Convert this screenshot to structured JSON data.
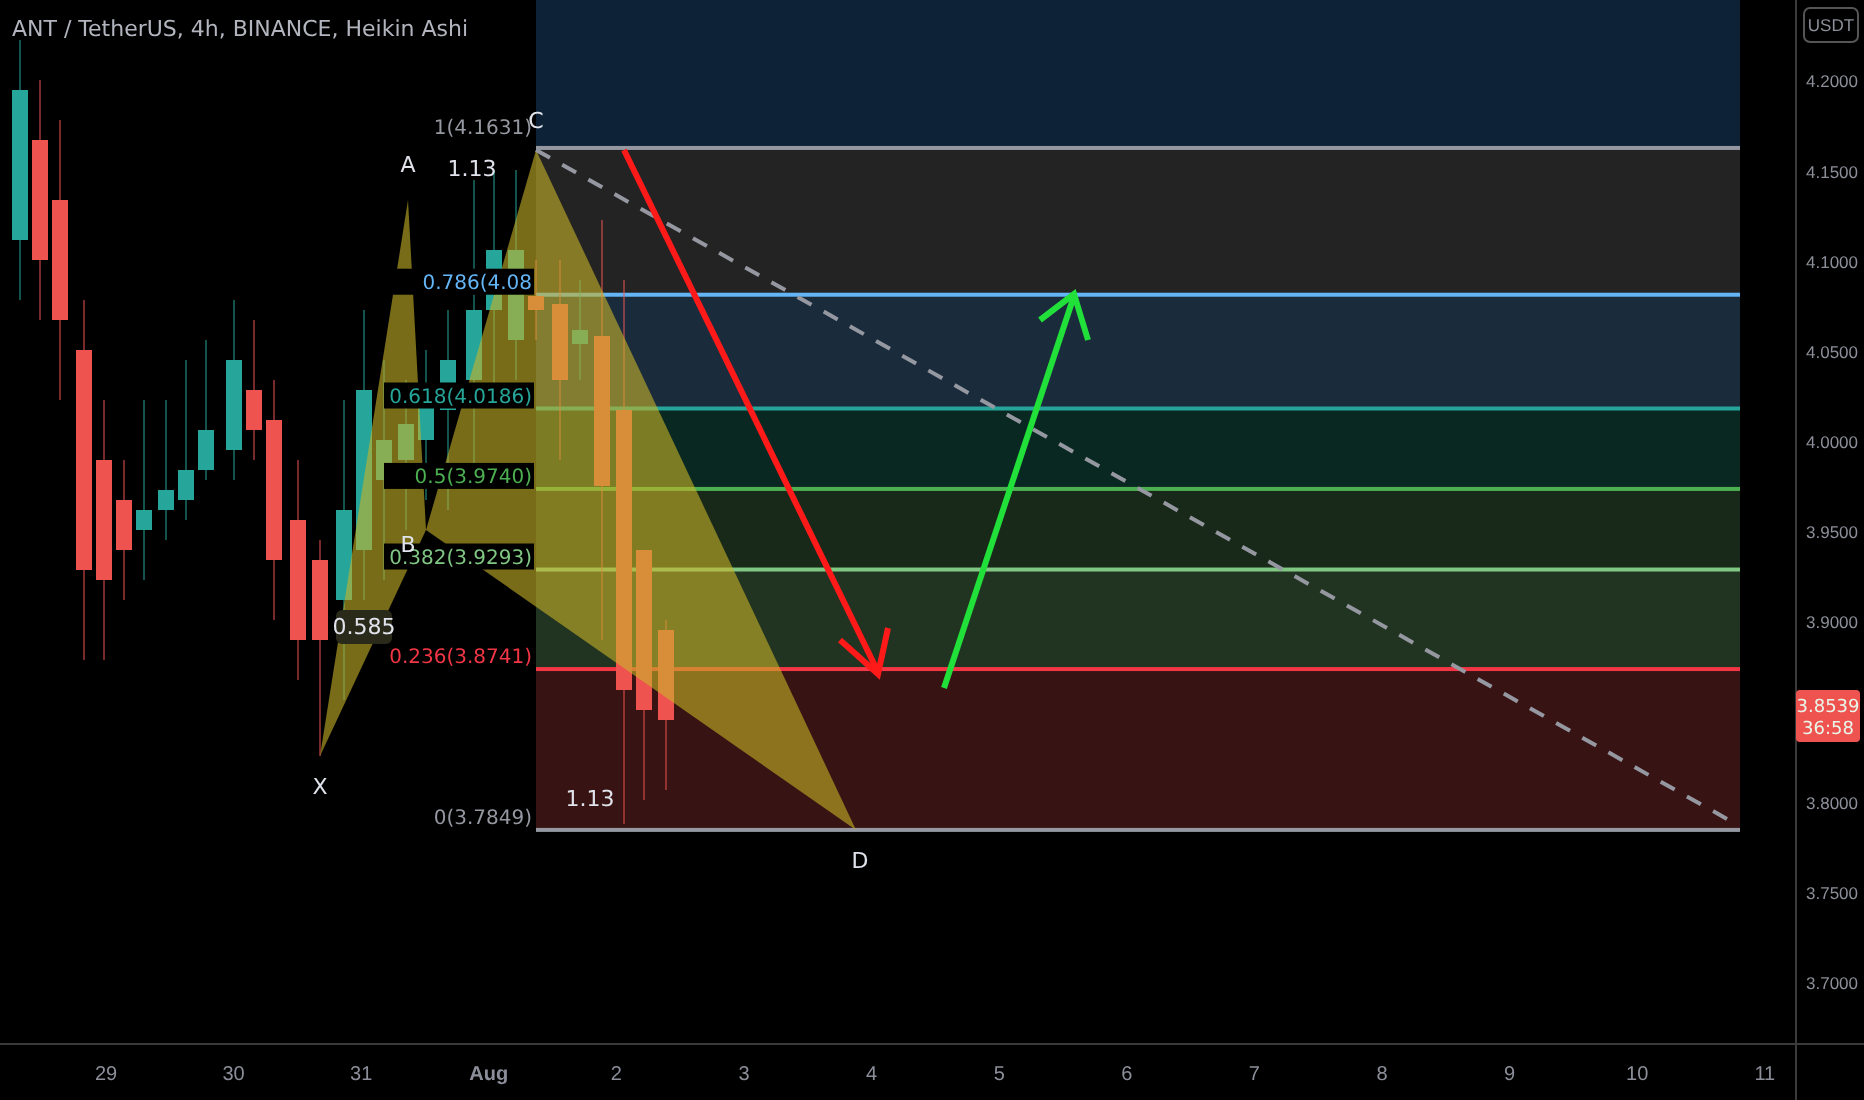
{
  "chart": {
    "title": "ANT / TetherUS, 4h, BINANCE, Heikin Ashi",
    "currency": "USDT",
    "last_price": "3.8539",
    "countdown": "36:58",
    "price_ticks": [
      "4.2000",
      "4.1500",
      "4.1000",
      "4.0500",
      "4.0000",
      "3.9500",
      "3.9000",
      "3.8000",
      "3.7500",
      "3.7000"
    ],
    "time_ticks": [
      {
        "label": "29",
        "kind": "day"
      },
      {
        "label": "30",
        "kind": "day"
      },
      {
        "label": "31",
        "kind": "day"
      },
      {
        "label": "Aug",
        "kind": "month"
      },
      {
        "label": "2",
        "kind": "day"
      },
      {
        "label": "3",
        "kind": "day"
      },
      {
        "label": "4",
        "kind": "day"
      },
      {
        "label": "5",
        "kind": "day"
      },
      {
        "label": "6",
        "kind": "day"
      },
      {
        "label": "7",
        "kind": "day"
      },
      {
        "label": "8",
        "kind": "day"
      },
      {
        "label": "9",
        "kind": "day"
      },
      {
        "label": "10",
        "kind": "day"
      },
      {
        "label": "11",
        "kind": "day"
      }
    ],
    "fib_levels": [
      {
        "label": "1(4.1631)",
        "color": "#9598a1"
      },
      {
        "label": "0.786(4.08",
        "color": "#64b5f6"
      },
      {
        "label": "0.618(4.0186)",
        "color": "#26a69a"
      },
      {
        "label": "0.5(3.9740)",
        "color": "#4caf50"
      },
      {
        "label": "0.382(3.9293)",
        "color": "#81c784"
      },
      {
        "label": "0.236(3.8741)",
        "color": "#f23645"
      },
      {
        "label": "0(3.7849)",
        "color": "#9598a1"
      }
    ],
    "pattern_points": [
      "X",
      "A",
      "B",
      "C",
      "D"
    ],
    "ratios": [
      {
        "text": "0.585",
        "kind": "boxed"
      },
      {
        "text": "1.13",
        "kind": "plain"
      },
      {
        "text": "1.13",
        "kind": "plain"
      }
    ]
  }
}
